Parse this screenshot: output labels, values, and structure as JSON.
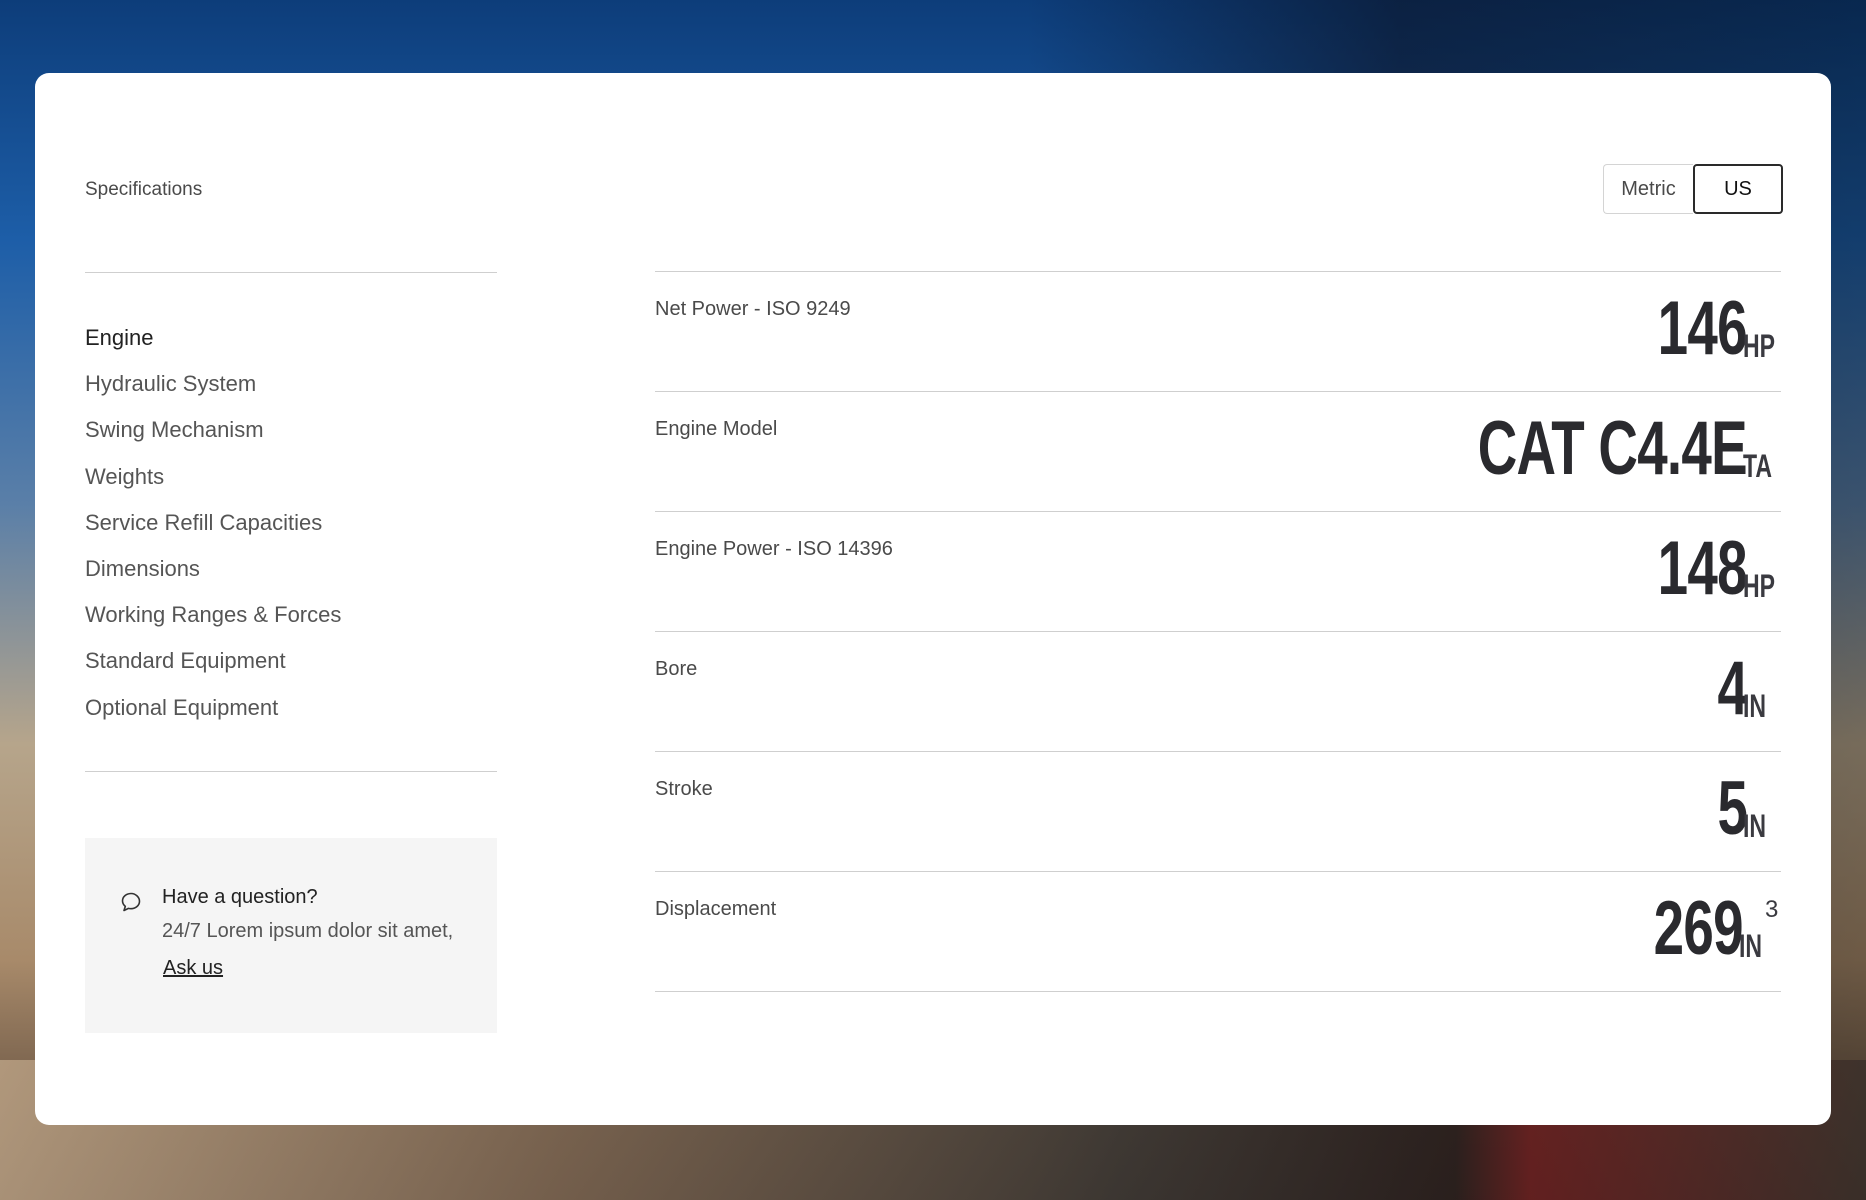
{
  "page": {
    "title": "Specifications"
  },
  "units_toggle": {
    "options": [
      "Metric",
      "US"
    ],
    "selected": "US"
  },
  "nav": {
    "active": "Engine",
    "items": [
      "Engine",
      "Hydraulic System",
      "Swing Mechanism",
      "Weights",
      "Service Refill Capacities",
      "Dimensions",
      "Working Ranges & Forces",
      "Standard Equipment",
      "Optional Equipment"
    ]
  },
  "help": {
    "title": "Have a question?",
    "text": "24/7 Lorem ipsum dolor sit amet,",
    "link": "Ask us",
    "icon": "chat-bubble-icon"
  },
  "specs": [
    {
      "label": "Net Power - ISO 9249",
      "value": "146",
      "unit": "HP"
    },
    {
      "label": "Engine Model",
      "value": "CAT C4.4E",
      "unit": "TA"
    },
    {
      "label": "Engine Power - ISO 14396",
      "value": "148",
      "unit": "HP"
    },
    {
      "label": "Bore",
      "value": "4",
      "unit": "IN"
    },
    {
      "label": "Stroke",
      "value": "5",
      "unit": "IN"
    },
    {
      "label": "Displacement",
      "value": "269",
      "unit": "IN",
      "unit_sup": "3"
    }
  ],
  "colors": {
    "text_dark": "#2a2a2e",
    "text_muted": "#555555",
    "divider": "#cfcfcf",
    "help_bg": "#f5f5f5"
  }
}
